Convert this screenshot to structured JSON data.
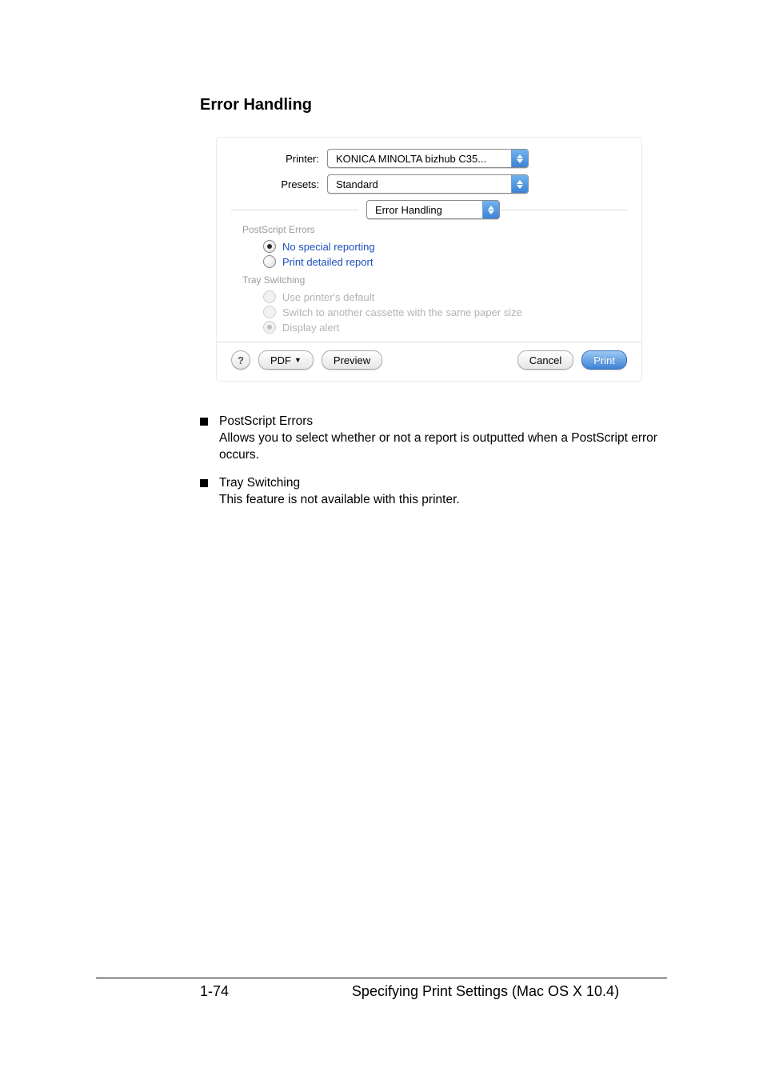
{
  "heading": "Error Handling",
  "dialog": {
    "printer_label": "Printer:",
    "printer_value": "KONICA MINOLTA bizhub C35...",
    "presets_label": "Presets:",
    "presets_value": "Standard",
    "section_value": "Error Handling",
    "ps_errors_title": "PostScript Errors",
    "ps_opt1": "No special reporting",
    "ps_opt2": "Print detailed report",
    "tray_title": "Tray Switching",
    "tray_opt1": "Use printer's default",
    "tray_opt2": "Switch to another cassette with the same paper size",
    "tray_opt3": "Display alert",
    "help": "?",
    "pdf_btn": "PDF",
    "preview_btn": "Preview",
    "cancel_btn": "Cancel",
    "print_btn": "Print"
  },
  "bullets": [
    {
      "title": "PostScript Errors",
      "desc": "Allows you to select whether or not a report is outputted when a PostScript error occurs."
    },
    {
      "title": "Tray Switching",
      "desc": "This feature is not available with this printer."
    }
  ],
  "footer": {
    "page": "1-74",
    "center": "Specifying Print Settings (Mac OS X 10.4)"
  }
}
